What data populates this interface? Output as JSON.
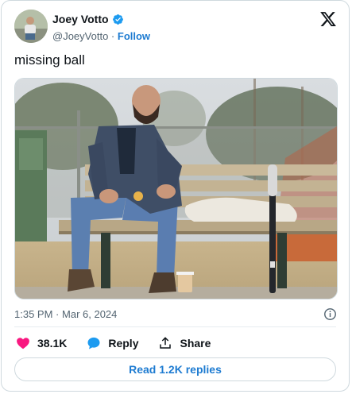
{
  "author": {
    "name": "Joey Votto",
    "handle": "@JoeyVotto",
    "separator": "·",
    "follow_label": "Follow"
  },
  "tweet": {
    "text": "missing ball",
    "time": "1:35 PM",
    "date_separator": "·",
    "date": "Mar 6, 2024"
  },
  "engagement": {
    "likes": "38.1K",
    "reply_label": "Reply",
    "share_label": "Share"
  },
  "replies_button": "Read 1.2K replies",
  "colors": {
    "accent": "#1d9bf0",
    "link_text": "#1d7bd1",
    "like_red": "#f91880",
    "secondary_text": "#536471",
    "border": "#cfd9de"
  },
  "icons": {
    "verified": "verified-badge-icon",
    "logo": "x-logo-icon",
    "info": "info-icon",
    "like": "heart-icon",
    "reply": "speech-bubble-icon",
    "share": "share-arrow-icon"
  }
}
